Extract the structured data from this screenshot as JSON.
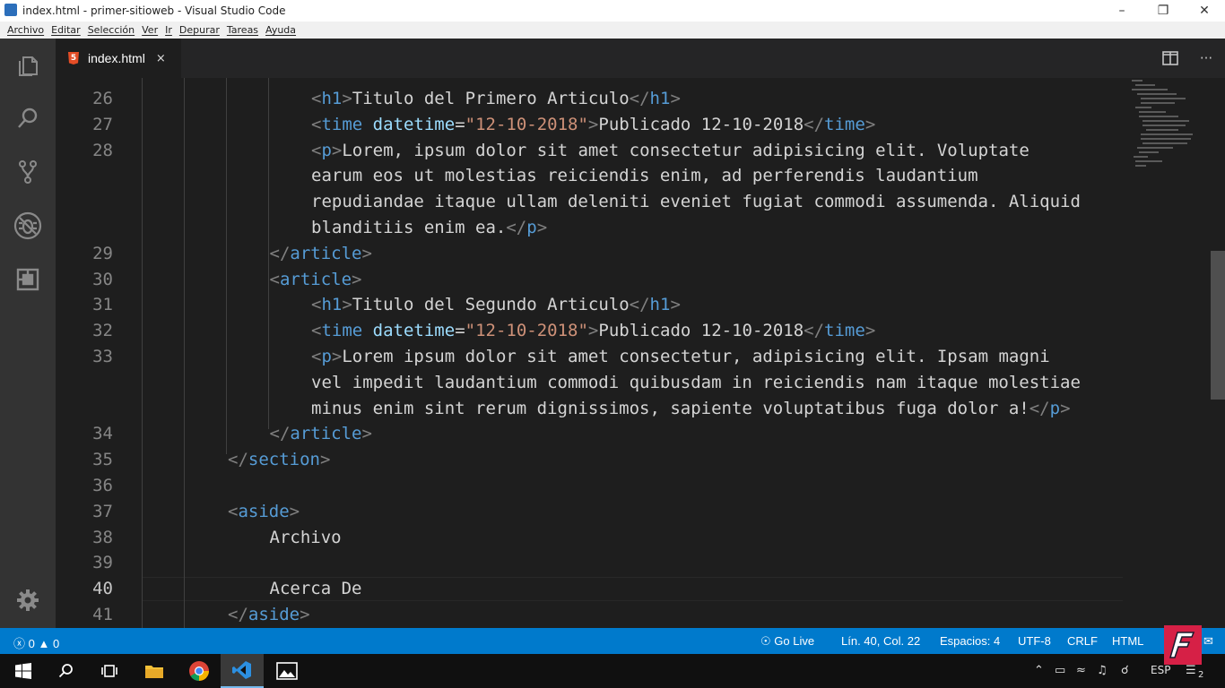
{
  "window": {
    "title": "index.html - primer-sitioweb - Visual Studio Code",
    "icon": "vscode-icon",
    "controls": [
      "minimize-icon",
      "maximize-icon",
      "close-icon"
    ]
  },
  "menu": {
    "items": [
      {
        "label": "Archivo"
      },
      {
        "label": "Editar"
      },
      {
        "label": "Selección"
      },
      {
        "label": "Ver"
      },
      {
        "label": "Ir"
      },
      {
        "label": "Depurar"
      },
      {
        "label": "Tareas"
      },
      {
        "label": "Ayuda"
      }
    ]
  },
  "activity_bar": {
    "icons": [
      "explorer-icon",
      "search-icon",
      "source-control-icon",
      "debug-icon",
      "extensions-icon"
    ],
    "bottom_icon": "gear-icon"
  },
  "tabs": [
    {
      "label": "index.html",
      "icon": "html5-icon",
      "icon_glyph": "5",
      "close": "×",
      "active": true
    }
  ],
  "editor_actions": {
    "split": "split-editor-icon",
    "more": "···"
  },
  "editor": {
    "current_line": 40,
    "lines": [
      {
        "num": "26",
        "indent": 2,
        "tokens": [
          [
            "bracket",
            "<"
          ],
          [
            "tag",
            "h1"
          ],
          [
            "bracket",
            ">"
          ],
          [
            "text",
            "Titulo del Primero Articulo"
          ],
          [
            "bracket",
            "</"
          ],
          [
            "tag",
            "h1"
          ],
          [
            "bracket",
            ">"
          ]
        ]
      },
      {
        "num": "27",
        "indent": 2,
        "tokens": [
          [
            "bracket",
            "<"
          ],
          [
            "tag",
            "time"
          ],
          [
            "text",
            " "
          ],
          [
            "attr",
            "datetime"
          ],
          [
            "text",
            "="
          ],
          [
            "str",
            "\"12-10-2018\""
          ],
          [
            "bracket",
            ">"
          ],
          [
            "text",
            "Publicado 12-10-2018"
          ],
          [
            "bracket",
            "</"
          ],
          [
            "tag",
            "time"
          ],
          [
            "bracket",
            ">"
          ]
        ]
      },
      {
        "num": "28",
        "indent": 2,
        "tokens": [
          [
            "bracket",
            "<"
          ],
          [
            "tag",
            "p"
          ],
          [
            "bracket",
            ">"
          ],
          [
            "text",
            "Lorem, ipsum dolor sit amet consectetur adipisicing elit. Voluptate"
          ]
        ]
      },
      {
        "num": "",
        "indent": 2,
        "tokens": [
          [
            "text",
            "earum eos ut molestias reiciendis enim, ad perferendis laudantium"
          ]
        ]
      },
      {
        "num": "",
        "indent": 2,
        "tokens": [
          [
            "text",
            "repudiandae itaque ullam deleniti eveniet fugiat commodi assumenda. Aliquid"
          ]
        ]
      },
      {
        "num": "",
        "indent": 2,
        "tokens": [
          [
            "text",
            "blanditiis enim ea."
          ],
          [
            "bracket",
            "</"
          ],
          [
            "tag",
            "p"
          ],
          [
            "bracket",
            ">"
          ]
        ]
      },
      {
        "num": "29",
        "indent": 1,
        "tokens": [
          [
            "bracket",
            "</"
          ],
          [
            "tag",
            "article"
          ],
          [
            "bracket",
            ">"
          ]
        ]
      },
      {
        "num": "30",
        "indent": 1,
        "tokens": [
          [
            "bracket",
            "<"
          ],
          [
            "tag",
            "article"
          ],
          [
            "bracket",
            ">"
          ]
        ]
      },
      {
        "num": "31",
        "indent": 2,
        "tokens": [
          [
            "bracket",
            "<"
          ],
          [
            "tag",
            "h1"
          ],
          [
            "bracket",
            ">"
          ],
          [
            "text",
            "Titulo del Segundo Articulo"
          ],
          [
            "bracket",
            "</"
          ],
          [
            "tag",
            "h1"
          ],
          [
            "bracket",
            ">"
          ]
        ]
      },
      {
        "num": "32",
        "indent": 2,
        "tokens": [
          [
            "bracket",
            "<"
          ],
          [
            "tag",
            "time"
          ],
          [
            "text",
            " "
          ],
          [
            "attr",
            "datetime"
          ],
          [
            "text",
            "="
          ],
          [
            "str",
            "\"12-10-2018\""
          ],
          [
            "bracket",
            ">"
          ],
          [
            "text",
            "Publicado 12-10-2018"
          ],
          [
            "bracket",
            "</"
          ],
          [
            "tag",
            "time"
          ],
          [
            "bracket",
            ">"
          ]
        ]
      },
      {
        "num": "33",
        "indent": 2,
        "tokens": [
          [
            "bracket",
            "<"
          ],
          [
            "tag",
            "p"
          ],
          [
            "bracket",
            ">"
          ],
          [
            "text",
            "Lorem ipsum dolor sit amet consectetur, adipisicing elit. Ipsam magni"
          ]
        ]
      },
      {
        "num": "",
        "indent": 2,
        "tokens": [
          [
            "text",
            "vel impedit laudantium commodi quibusdam in reiciendis nam itaque molestiae"
          ]
        ]
      },
      {
        "num": "",
        "indent": 2,
        "tokens": [
          [
            "text",
            "minus enim sint rerum dignissimos, sapiente voluptatibus fuga dolor a!"
          ],
          [
            "bracket",
            "</"
          ],
          [
            "tag",
            "p"
          ],
          [
            "bracket",
            ">"
          ]
        ]
      },
      {
        "num": "34",
        "indent": 1,
        "tokens": [
          [
            "bracket",
            "</"
          ],
          [
            "tag",
            "article"
          ],
          [
            "bracket",
            ">"
          ]
        ]
      },
      {
        "num": "35",
        "indent": 0,
        "tokens": [
          [
            "bracket",
            "</"
          ],
          [
            "tag",
            "section"
          ],
          [
            "bracket",
            ">"
          ]
        ]
      },
      {
        "num": "36",
        "indent": 0,
        "tokens": []
      },
      {
        "num": "37",
        "indent": 0,
        "tokens": [
          [
            "bracket",
            "<"
          ],
          [
            "tag",
            "aside"
          ],
          [
            "bracket",
            ">"
          ]
        ]
      },
      {
        "num": "38",
        "indent": 1,
        "tokens": [
          [
            "text",
            "Archivo"
          ]
        ]
      },
      {
        "num": "39",
        "indent": 1,
        "tokens": []
      },
      {
        "num": "40",
        "indent": 1,
        "tokens": [
          [
            "text",
            "Acerca De"
          ]
        ]
      },
      {
        "num": "41",
        "indent": 0,
        "tokens": [
          [
            "bracket",
            "</"
          ],
          [
            "tag",
            "aside"
          ],
          [
            "bracket",
            ">"
          ]
        ]
      }
    ]
  },
  "status_bar": {
    "errors": "0",
    "warnings": "0",
    "go_live": "Go Live",
    "position": "Lín. 40, Col. 22",
    "spaces": "Espacios: 4",
    "encoding": "UTF-8",
    "eol": "CRLF",
    "language": "HTML"
  },
  "taskbar": {
    "icons": [
      "start-icon",
      "search-icon",
      "task-view-icon",
      "file-explorer-icon",
      "chrome-icon",
      "vscode-icon",
      "photos-icon"
    ],
    "tray_icons": [
      "chevron-up-icon",
      "battery-icon",
      "wifi-icon",
      "volume-icon",
      "network-icon"
    ],
    "language": "ESP",
    "notifications": "2"
  },
  "watermark": {
    "letter": "F"
  },
  "colors": {
    "status_bar": "#007acc",
    "editor_bg": "#1e1e1e",
    "activity_bar": "#333333",
    "tag": "#569cd6",
    "attr": "#9cdcfe",
    "string": "#ce9178",
    "watermark": "#d62046"
  }
}
